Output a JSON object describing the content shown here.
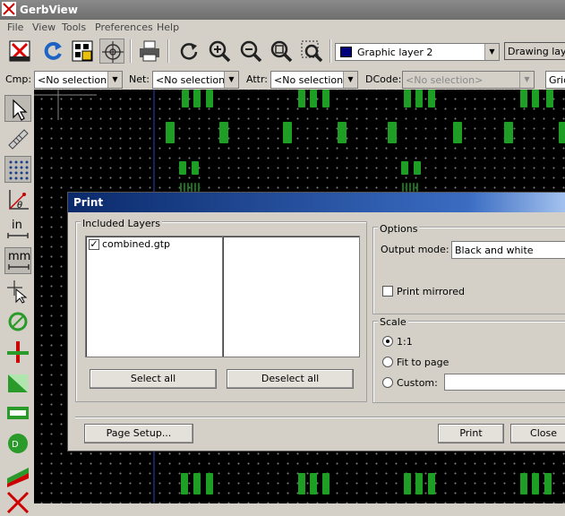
{
  "window": {
    "title": "GerbView"
  },
  "menu": [
    "File",
    "View",
    "Tools",
    "Preferences",
    "Help"
  ],
  "toolbar": {
    "layer_select": "Graphic layer 2",
    "layer_color": "#00007a",
    "drawing_mode": "Drawing laye"
  },
  "selection_bar": {
    "cmp_label": "Cmp:",
    "cmp_value": "<No selection>",
    "net_label": "Net:",
    "net_value": "<No selection>",
    "attr_label": "Attr:",
    "attr_value": "<No selection>",
    "dcode_label": "DCode:",
    "dcode_value": "<No selection>",
    "grid_value": "Grid"
  },
  "left_toolbar": {
    "in_label": "in",
    "mm_label": "mm"
  },
  "colors": {
    "pad": "#1f9e26",
    "pad_dark": "#17701b",
    "canvas": "#000000",
    "dialog_title": "#0b2a6b"
  },
  "dialog": {
    "title": "Print",
    "included_layers": {
      "label": "Included Layers",
      "layers": [
        {
          "name": "combined.gtp",
          "checked": true
        }
      ],
      "select_all": "Select all",
      "deselect_all": "Deselect all"
    },
    "options": {
      "label": "Options",
      "output_mode_label": "Output mode:",
      "output_mode_value": "Black and white",
      "print_mirrored": "Print mirrored"
    },
    "scale": {
      "label": "Scale",
      "options": [
        "1:1",
        "Fit to page",
        "Custom:"
      ],
      "selected": "1:1"
    },
    "page_setup": "Page Setup...",
    "print": "Print",
    "close": "Close"
  }
}
